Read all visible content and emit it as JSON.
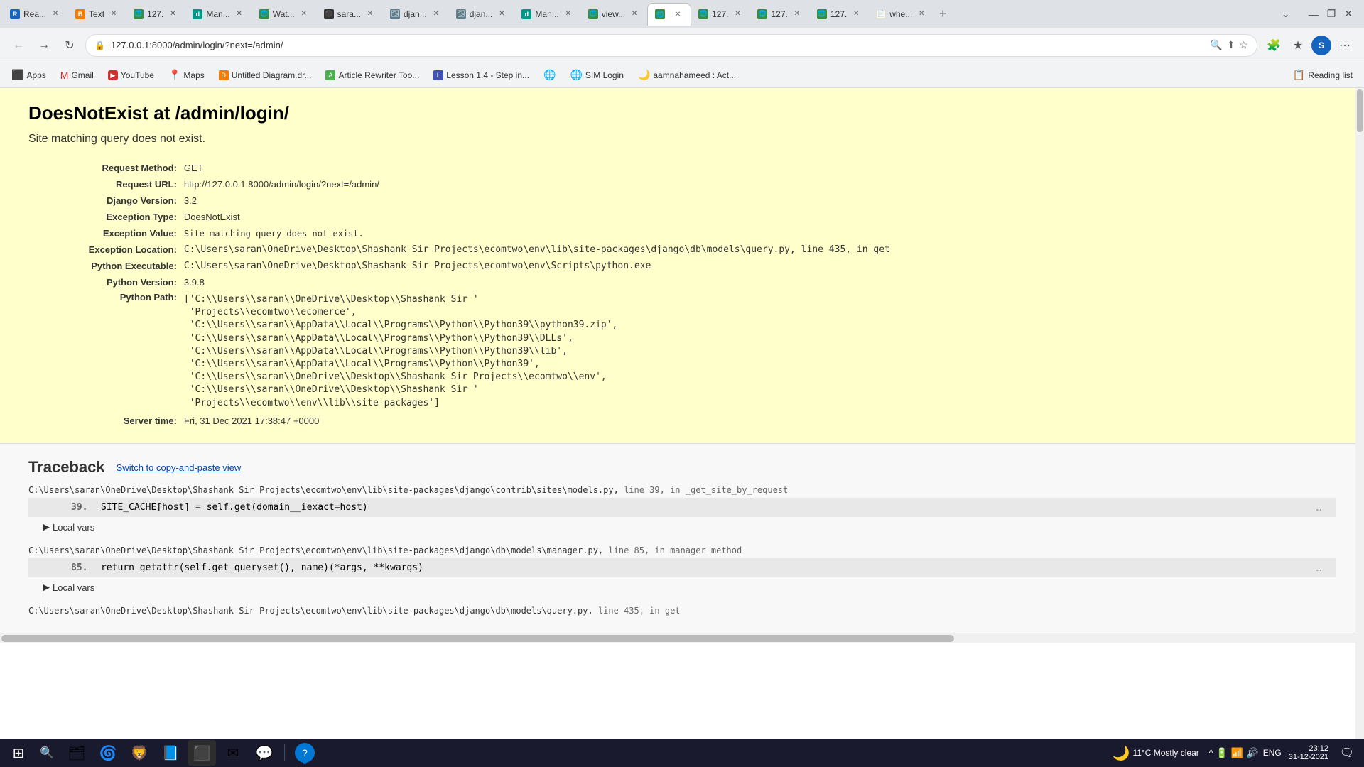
{
  "tabs": [
    {
      "id": 1,
      "favicon_color": "#1565c0",
      "label": "Rea...",
      "active": false,
      "favicon_text": "R"
    },
    {
      "id": 2,
      "favicon_color": "#f57c00",
      "label": "Text",
      "active": false,
      "favicon_text": "B"
    },
    {
      "id": 3,
      "favicon_color": "#388e3c",
      "label": "127.",
      "active": false,
      "favicon_text": "🌐"
    },
    {
      "id": 4,
      "favicon_color": "#009688",
      "label": "Man...",
      "active": false,
      "favicon_text": "d"
    },
    {
      "id": 5,
      "favicon_color": "#388e3c",
      "label": "Wat...",
      "active": false,
      "favicon_text": "🌐"
    },
    {
      "id": 6,
      "favicon_color": "#6d6d6d",
      "label": "sara...",
      "active": false,
      "favicon_text": "⚫"
    },
    {
      "id": 7,
      "favicon_color": "#6d6d6d",
      "label": "djan...",
      "active": false,
      "favicon_text": "🌫"
    },
    {
      "id": 8,
      "favicon_color": "#6d6d6d",
      "label": "djan...",
      "active": false,
      "favicon_text": "🌫"
    },
    {
      "id": 9,
      "favicon_color": "#009688",
      "label": "Man...",
      "active": false,
      "favicon_text": "d"
    },
    {
      "id": 10,
      "favicon_color": "#388e3c",
      "label": "view...",
      "active": false,
      "favicon_text": "🌐"
    },
    {
      "id": 11,
      "favicon_color": "#388e3c",
      "label": "",
      "active": true,
      "favicon_text": "🌐"
    },
    {
      "id": 12,
      "favicon_color": "#388e3c",
      "label": "127.",
      "active": false,
      "favicon_text": "🌐"
    },
    {
      "id": 13,
      "favicon_color": "#388e3c",
      "label": "127.",
      "active": false,
      "favicon_text": "🌐"
    },
    {
      "id": 14,
      "favicon_color": "#388e3c",
      "label": "127.",
      "active": false,
      "favicon_text": "🌐"
    },
    {
      "id": 15,
      "favicon_color": "#f57c00",
      "label": "whe...",
      "active": false,
      "favicon_text": "📄"
    }
  ],
  "address_bar": {
    "url": "127.0.0.1:8000/admin/login/?next=/admin/"
  },
  "bookmarks": [
    {
      "label": "Apps",
      "favicon": "⬛"
    },
    {
      "label": "Gmail",
      "favicon": "M"
    },
    {
      "label": "YouTube",
      "favicon": "▶"
    },
    {
      "label": "Maps",
      "favicon": "📍"
    },
    {
      "label": "Untitled Diagram.dr...",
      "favicon": "🔶"
    },
    {
      "label": "Article Rewriter Too...",
      "favicon": "📝"
    },
    {
      "label": "Lesson 1.4 - Step in...",
      "favicon": "📚"
    },
    {
      "label": "",
      "favicon": "🌐"
    },
    {
      "label": "SIM Login",
      "favicon": "🌐"
    },
    {
      "label": "aamnahameed : Act...",
      "favicon": "🌙"
    }
  ],
  "reading_list": "Reading list",
  "error": {
    "title": "DoesNotExist at /admin/login/",
    "subtitle": "Site matching query does not exist.",
    "fields": [
      {
        "label": "Request Method:",
        "value": "GET"
      },
      {
        "label": "Request URL:",
        "value": "http://127.0.0.1:8000/admin/login/?next=/admin/"
      },
      {
        "label": "Django Version:",
        "value": "3.2"
      },
      {
        "label": "Exception Type:",
        "value": "DoesNotExist"
      },
      {
        "label": "Exception Value:",
        "value": "Site matching query does not exist."
      },
      {
        "label": "Exception Location:",
        "value": "C:\\Users\\saran\\OneDrive\\Desktop\\Shashank Sir Projects\\ecomtwo\\env\\lib\\site-packages\\django\\db\\models\\query.py, line 435, in get"
      },
      {
        "label": "Python Executable:",
        "value": "C:\\Users\\saran\\OneDrive\\Desktop\\Shashank Sir Projects\\ecomtwo\\env\\Scripts\\python.exe"
      },
      {
        "label": "Python Version:",
        "value": "3.9.8"
      },
      {
        "label": "Python Path:",
        "value": "['C:\\\\Users\\\\saran\\\\OneDrive\\\\Desktop\\\\Shashank Sir '\n 'Projects\\\\ecomtwo\\\\ecomerce',\n 'C:\\\\Users\\\\saran\\\\AppData\\\\Local\\\\Programs\\\\Python\\\\Python39\\\\python39.zip',\n 'C:\\\\Users\\\\saran\\\\AppData\\\\Local\\\\Programs\\\\Python\\\\Python39\\\\DLLs',\n 'C:\\\\Users\\\\saran\\\\AppData\\\\Local\\\\Programs\\\\Python\\\\Python39\\\\lib',\n 'C:\\\\Users\\\\saran\\\\AppData\\\\Local\\\\Programs\\\\Python\\\\Python39',\n 'C:\\\\Users\\\\saran\\\\OneDrive\\\\Desktop\\\\Shashank Sir Projects\\\\ecomtwo\\\\env',\n 'C:\\\\Users\\\\saran\\\\OneDrive\\\\Desktop\\\\Shashank Sir '\n 'Projects\\\\ecomtwo\\\\env\\\\lib\\\\site-packages']"
      },
      {
        "label": "Server time:",
        "value": "Fri, 31 Dec 2021 17:38:47 +0000"
      }
    ]
  },
  "traceback": {
    "title": "Traceback",
    "switch_link": "Switch to copy-and-paste view",
    "frames": [
      {
        "file": "C:\\Users\\saran\\OneDrive\\Desktop\\Shashank Sir Projects\\ecomtwo\\env\\lib\\site-packages\\django\\contrib\\sites\\models.py",
        "line": "line 39",
        "func": "_get_site_by_request",
        "code_line": "39.",
        "code": "SITE_CACHE[host] = self.get(domain__iexact=host)",
        "has_local_vars": true
      },
      {
        "file": "C:\\Users\\saran\\OneDrive\\Desktop\\Shashank Sir Projects\\ecomtwo\\env\\lib\\site-packages\\django\\db\\models\\manager.py",
        "line": "line 85",
        "func": "manager_method",
        "code_line": "85.",
        "code": "return getattr(self.get_queryset(), name)(*args, **kwargs)",
        "has_local_vars": true
      },
      {
        "file": "C:\\Users\\saran\\OneDrive\\Desktop\\Shashank Sir Projects\\ecomtwo\\env\\lib\\site-packages\\django\\db\\models\\query.py",
        "line": "line 435",
        "func": "get",
        "code_line": "",
        "code": "",
        "has_local_vars": false
      }
    ]
  },
  "taskbar": {
    "time": "23:12",
    "date": "31-12-2021",
    "weather": "11°C  Mostly clear",
    "language": "ENG"
  }
}
